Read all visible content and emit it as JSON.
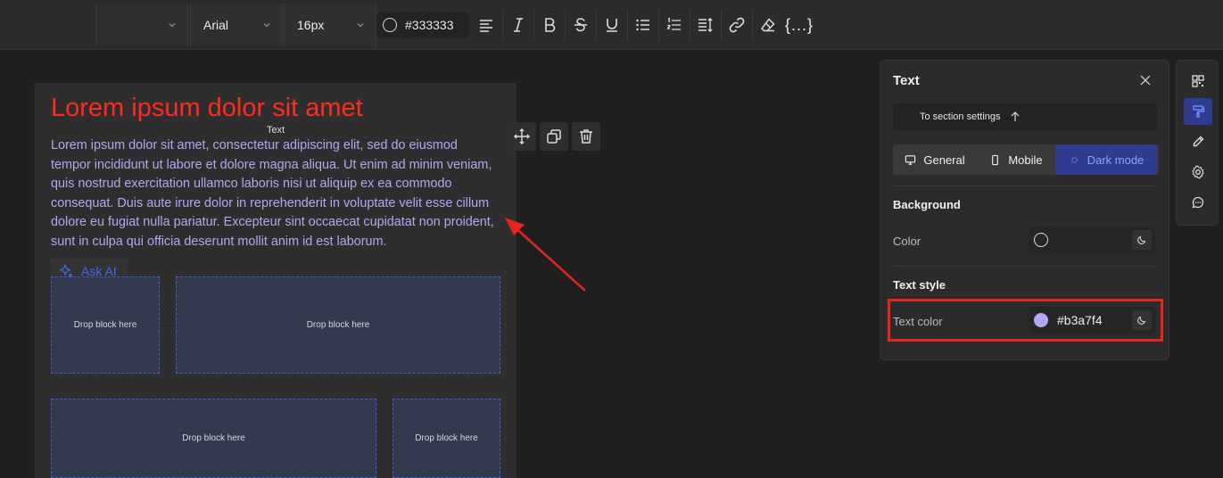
{
  "toolbar": {
    "block_type_value": "",
    "font_family": "Arial",
    "font_size": "16px",
    "text_color": "#333333",
    "merge_tags_label": "{...}"
  },
  "canvas": {
    "heading": "Lorem ipsum dolor sit amet",
    "text_tag": "Text",
    "body": "Lorem ipsum dolor sit amet, consectetur adipiscing elit, sed do eiusmod tempor incididunt ut labore et dolore magna aliqua. Ut enim ad minim veniam, quis nostrud exercitation ullamco laboris nisi ut aliquip ex ea commodo consequat. Duis aute irure dolor in reprehenderit in voluptate velit esse cillum dolore eu fugiat nulla pariatur. Excepteur sint occaecat cupidatat non proident, sunt in culpa qui officia deserunt mollit anim id est laborum.",
    "ask_ai": "Ask AI",
    "drop_label_1": "Drop block here",
    "drop_label_2": "Drop block here",
    "drop_label_3": "Drop block here",
    "drop_label_4": "Drop block here"
  },
  "panel": {
    "title": "Text",
    "to_section": "To section settings",
    "tabs": [
      "General",
      "Mobile",
      "Dark mode"
    ],
    "active_tab": "Dark mode",
    "background_title": "Background",
    "background_color_label": "Color",
    "background_color_value": "",
    "text_style_title": "Text style",
    "text_color_label": "Text color",
    "text_color_value": "#b3a7f4"
  },
  "colors": {
    "heading": "#ff2b1c",
    "body_text": "#b3a7f4",
    "accent": "#2f3c8f",
    "highlight": "#e8251c"
  }
}
